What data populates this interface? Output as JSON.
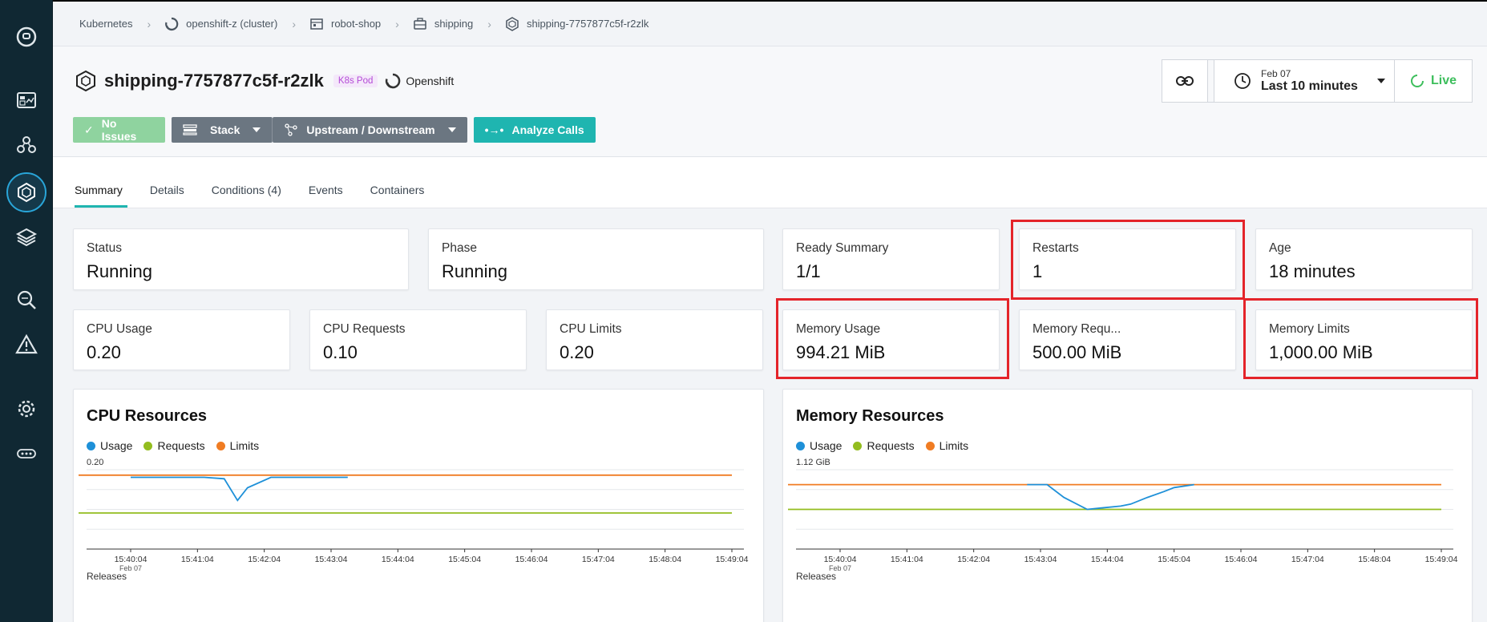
{
  "breadcrumb": [
    {
      "label": "Kubernetes",
      "icon": "none"
    },
    {
      "label": "openshift-z (cluster)",
      "icon": "cluster-icon"
    },
    {
      "label": "robot-shop",
      "icon": "namespace-icon"
    },
    {
      "label": "shipping",
      "icon": "deployment-icon"
    },
    {
      "label": "shipping-7757877c5f-r2zlk",
      "icon": "pod-icon"
    }
  ],
  "header": {
    "title": "shipping-7757877c5f-r2zlk",
    "badge": "K8s Pod",
    "platform": "Openshift",
    "actions": {
      "no_issues": "No Issues",
      "stack": "Stack",
      "upstream": "Upstream / Downstream",
      "analyze": "Analyze Calls"
    },
    "time": {
      "date": "Feb 07",
      "range": "Last 10 minutes"
    },
    "live": "Live"
  },
  "tabs": [
    "Summary",
    "Details",
    "Conditions (4)",
    "Events",
    "Containers"
  ],
  "active_tab": "Summary",
  "stats_row1": [
    {
      "label": "Status",
      "value": "Running"
    },
    {
      "label": "Phase",
      "value": "Running"
    },
    {
      "label": "Ready Summary",
      "value": "1/1"
    },
    {
      "label": "Restarts",
      "value": "1"
    },
    {
      "label": "Age",
      "value": "18 minutes"
    }
  ],
  "stats_row2": [
    {
      "label": "CPU Usage",
      "value": "0.20"
    },
    {
      "label": "CPU Requests",
      "value": "0.10"
    },
    {
      "label": "CPU Limits",
      "value": "0.20"
    },
    {
      "label": "Memory Usage",
      "value": "994.21 MiB"
    },
    {
      "label": "Memory Requ...",
      "value": "500.00 MiB"
    },
    {
      "label": "Memory Limits",
      "value": "1,000.00 MiB"
    }
  ],
  "colors": {
    "usage": "#1e90d8",
    "requests": "#93bd1f",
    "limits": "#f07c23",
    "accent": "#1fb5b0",
    "highlight": "#e4242a",
    "sidebar": "#102833"
  },
  "legend": [
    "Usage",
    "Requests",
    "Limits"
  ],
  "releases_label": "Releases",
  "chart_data": [
    {
      "type": "line",
      "title": "CPU Resources",
      "y_top_label": "0.20",
      "x_ticks": [
        "15:40:04",
        "15:41:04",
        "15:42:04",
        "15:43:04",
        "15:44:04",
        "15:45:04",
        "15:46:04",
        "15:47:04",
        "15:48:04",
        "15:49:04"
      ],
      "x_sub_label": "Feb 07",
      "ylim": [
        0,
        0.22
      ],
      "series": [
        {
          "name": "Usage",
          "x": [
            0,
            0.6,
            1.1,
            1.4,
            1.6,
            1.75,
            2.1,
            3.0,
            3.25
          ],
          "values": [
            0.199,
            0.199,
            0.199,
            0.195,
            0.135,
            0.17,
            0.199,
            0.199,
            0.199
          ]
        },
        {
          "name": "Requests",
          "x": [
            0,
            9.9
          ],
          "values": [
            0.1,
            0.1
          ]
        },
        {
          "name": "Limits",
          "x": [
            0,
            9.9
          ],
          "values": [
            0.205,
            0.205
          ]
        }
      ]
    },
    {
      "type": "line",
      "title": "Memory Resources",
      "y_top_label": "1.12 GiB",
      "x_ticks": [
        "15:40:04",
        "15:41:04",
        "15:42:04",
        "15:43:04",
        "15:44:04",
        "15:45:04",
        "15:46:04",
        "15:47:04",
        "15:48:04",
        "15:49:04"
      ],
      "x_sub_label": "Feb 07",
      "ylim": [
        0,
        1.2
      ],
      "series": [
        {
          "name": "Usage",
          "x": [
            2.8,
            3.1,
            3.35,
            3.7,
            3.9,
            4.2,
            4.35,
            4.6,
            4.85,
            5.0,
            5.3
          ],
          "values": [
            0.975,
            0.975,
            0.78,
            0.6,
            0.62,
            0.65,
            0.68,
            0.78,
            0.87,
            0.93,
            0.975
          ]
        },
        {
          "name": "Requests",
          "x": [
            0,
            9.9
          ],
          "values": [
            0.6,
            0.6
          ]
        },
        {
          "name": "Limits",
          "x": [
            0,
            9.9
          ],
          "values": [
            0.975,
            0.975
          ]
        }
      ]
    }
  ]
}
